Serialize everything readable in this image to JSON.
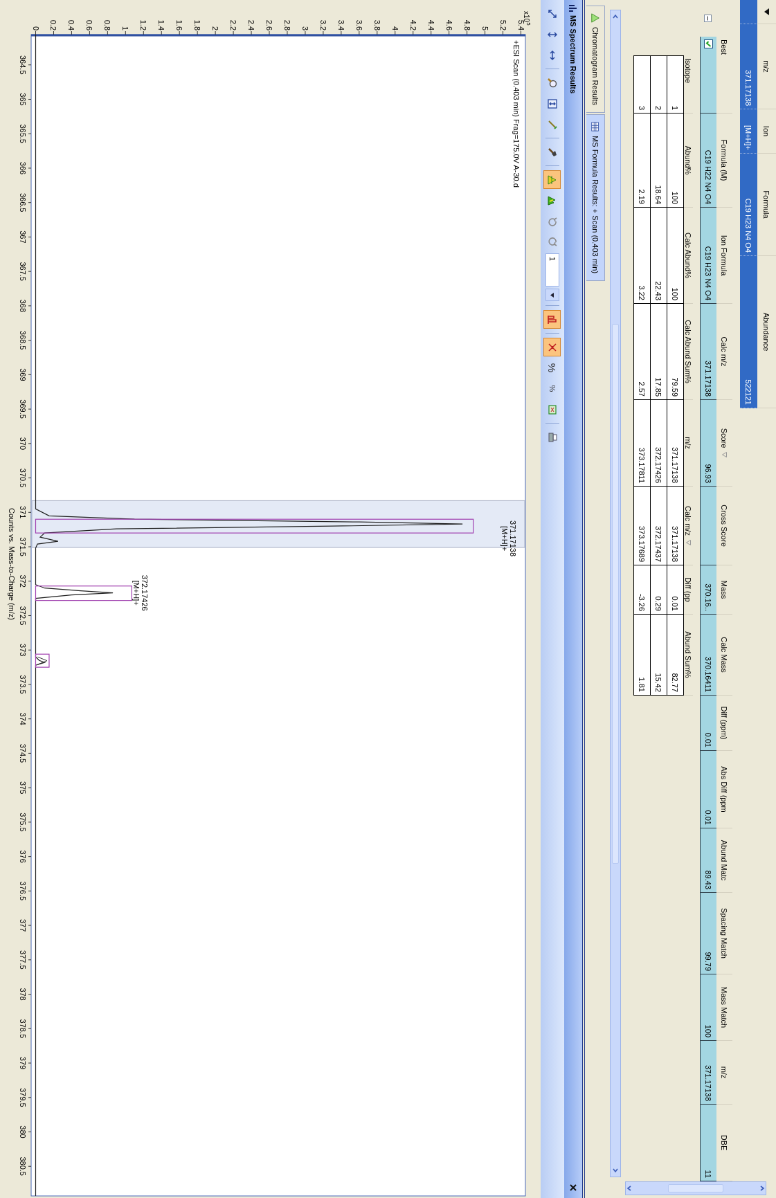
{
  "top_grid": {
    "headers": [
      "m/z",
      "Ion",
      "Formula",
      "Abundance"
    ],
    "entries": [
      {
        "values": [
          "371.17138",
          "[M+H]+",
          "C19 H23 N4 O4",
          "522121"
        ],
        "selected": true
      }
    ]
  },
  "results": {
    "headers": [
      {
        "label": "Best",
        "sorted": false
      },
      {
        "label": "Formula (M)",
        "sorted": false
      },
      {
        "label": "Ion Formula",
        "sorted": false
      },
      {
        "label": "Calc m/z",
        "sorted": false
      },
      {
        "label": "Score",
        "sorted": true
      },
      {
        "label": "Cross Score",
        "sorted": false
      },
      {
        "label": "Mass",
        "sorted": false
      },
      {
        "label": "Calc Mass",
        "sorted": false
      },
      {
        "label": "Diff (ppm)",
        "sorted": false
      },
      {
        "label": "Abs Diff (ppm",
        "sorted": false
      },
      {
        "label": "Abund Matc",
        "sorted": false
      },
      {
        "label": "Spacing Match",
        "sorted": false
      },
      {
        "label": "Mass Match",
        "sorted": false
      },
      {
        "label": "m/z",
        "sorted": false
      },
      {
        "label": "DBE",
        "sorted": false
      }
    ],
    "entries": [
      {
        "checked": true,
        "selected": true,
        "expanded": true,
        "values": [
          "C19 H22 N4 O4",
          "C19 H23 N4 O4",
          "371.17138",
          "96.93"
        ],
        "values_after_blank": [
          "370.16..",
          "370.16411",
          "0.01",
          "0.01",
          "89.43",
          "99.79",
          "100",
          "371.17138",
          "11"
        ],
        "isotopes": {
          "headers": [
            {
              "label": "Isotope",
              "sorted": false
            },
            {
              "label": "Abund%",
              "sorted": false
            },
            {
              "label": "Calc Abund%",
              "sorted": false
            },
            {
              "label": "Calc Abund Sum%",
              "sorted": false
            },
            {
              "label": "m/z",
              "sorted": false
            },
            {
              "label": "Calc m/z",
              "sorted": true
            },
            {
              "label": "Diff (pp",
              "sorted": false
            },
            {
              "label": "Abund Sum%",
              "sorted": false
            }
          ],
          "entries": [
            {
              "values": [
                "1",
                "100",
                "100",
                "79.59",
                "371.17138",
                "371.17138",
                "0.01",
                "82.77"
              ]
            },
            {
              "values": [
                "2",
                "18.64",
                "22.43",
                "17.85",
                "372.17426",
                "372.17437",
                "0.29",
                "15.42"
              ]
            },
            {
              "values": [
                "3",
                "2.19",
                "3.22",
                "2.57",
                "373.17811",
                "373.17689",
                "-3.26",
                "1.81"
              ]
            }
          ]
        }
      }
    ]
  },
  "tabs": [
    {
      "label": "Chromatogram Results",
      "kind": "chromatogram",
      "selected": false
    },
    {
      "label": "MS Formula Results: + Scan (0.403 min)",
      "kind": "formula",
      "selected": true
    }
  ],
  "spectrum_panel": {
    "title": "MS Spectrum Results",
    "toolbar": [
      [
        {
          "kind": "expand",
          "selected": false
        },
        {
          "kind": "vspan",
          "selected": false
        },
        {
          "kind": "hspan",
          "selected": false
        }
      ],
      [
        {
          "kind": "zoom",
          "selected": false
        },
        {
          "kind": "fit",
          "selected": false
        },
        {
          "kind": "wand",
          "selected": false
        }
      ],
      [
        {
          "kind": "pick",
          "selected": false
        }
      ],
      [
        {
          "kind": "labels",
          "selected": true
        },
        {
          "kind": "peaks",
          "selected": false
        },
        {
          "kind": "undo",
          "selected": false
        },
        {
          "kind": "redo",
          "selected": false
        },
        {
          "kind": "spin",
          "value": "1"
        }
      ],
      [
        {
          "kind": "bars",
          "selected": true
        }
      ],
      [
        {
          "kind": "exclude",
          "selected": true
        },
        {
          "kind": "percent",
          "label": "%",
          "selected": false
        },
        {
          "kind": "percentsmall",
          "label": "%",
          "selected": false
        },
        {
          "kind": "grid",
          "selected": false
        }
      ],
      [
        {
          "kind": "print",
          "selected": false
        }
      ]
    ],
    "plot": {
      "title": "+ESI Scan (0.403 min) Frag=175.0V A-30.d",
      "multiplier": {
        "base": "x10",
        "exponent": "5"
      },
      "count_ticks": [
        "0",
        "0.2",
        "0.4",
        "0.6",
        "0.8",
        "1",
        "1.2",
        "1.4",
        "1.6",
        "1.8",
        "2",
        "2.2",
        "2.4",
        "2.6",
        "2.8",
        "3",
        "3.2",
        "3.4",
        "3.6",
        "3.8",
        "4",
        "4.2",
        "4.4",
        "4.6",
        "4.8",
        "5",
        "5.2",
        "5.4"
      ],
      "mz_ticks": [
        "364.5",
        "365",
        "365.5",
        "366",
        "366.5",
        "367",
        "367.5",
        "368",
        "368.5",
        "369",
        "369.5",
        "370",
        "370.5",
        "371",
        "371.5",
        "372",
        "372.5",
        "373",
        "373.5",
        "374",
        "374.5",
        "375",
        "375.5",
        "376",
        "376.5",
        "377",
        "377.5",
        "378",
        "378.5",
        "379",
        "379.5",
        "380",
        "380.5"
      ],
      "axis_title": "Counts vs. Mass-to-Charge (m/z)",
      "peak_labels": [
        {
          "mz": "371.17138",
          "ion": "[M+H]+"
        },
        {
          "mz": "372.17426",
          "ion": "[M+H]+"
        }
      ]
    }
  }
}
